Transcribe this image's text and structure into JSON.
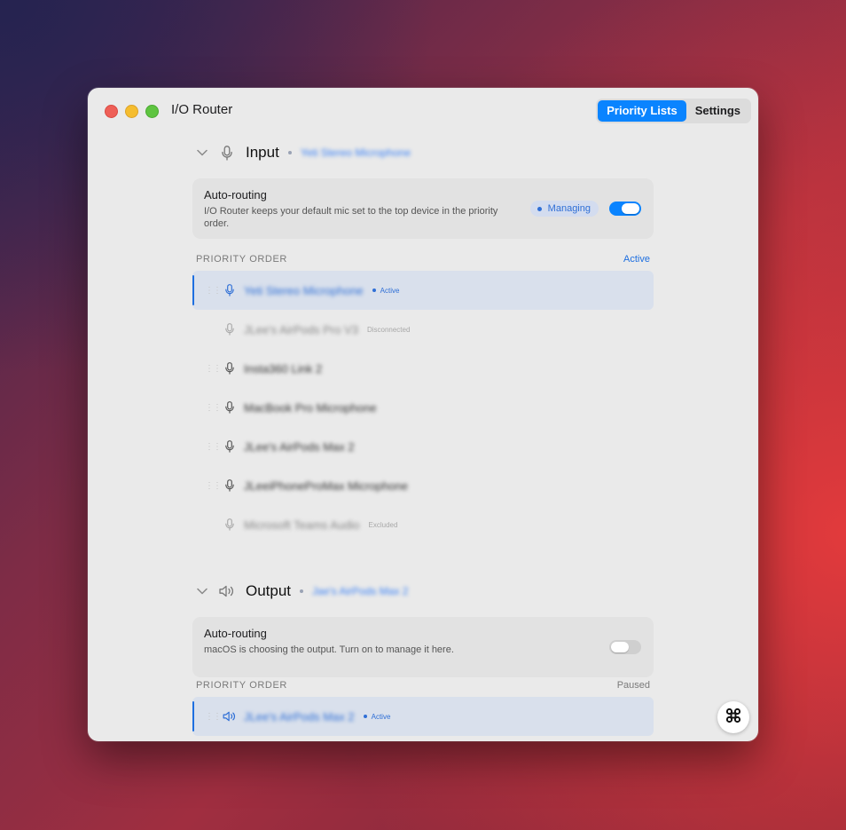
{
  "window": {
    "title": "I/O Router"
  },
  "tabs": [
    {
      "label": "Priority Lists",
      "active": true
    },
    {
      "label": "Settings",
      "active": false
    }
  ],
  "input": {
    "title": "Input",
    "current_device": "Yeti Stereo Microphone",
    "auto_routing": {
      "title": "Auto-routing",
      "description": "I/O Router keeps your default mic set to the top device in the priority order.",
      "status_pill": "Managing",
      "enabled": true
    },
    "priority_order_label": "PRIORITY ORDER",
    "priority_state": "Active",
    "devices": [
      {
        "name": "Yeti Stereo Microphone",
        "status": "Active"
      },
      {
        "name": "JLee's AirPods Pro V3",
        "status": "Disconnected"
      },
      {
        "name": "Insta360 Link 2",
        "status": ""
      },
      {
        "name": "MacBook Pro Microphone",
        "status": ""
      },
      {
        "name": "JLee's AirPods Max 2",
        "status": ""
      },
      {
        "name": "JLeeiPhoneProMax Microphone",
        "status": ""
      },
      {
        "name": "Microsoft Teams Audio",
        "status": "Excluded"
      }
    ]
  },
  "output": {
    "title": "Output",
    "current_device": "Jae's AirPods Max 2",
    "auto_routing": {
      "title": "Auto-routing",
      "description": "macOS is choosing the output. Turn on to manage it here.",
      "enabled": false
    },
    "priority_order_label": "PRIORITY ORDER",
    "priority_state": "Paused",
    "devices": [
      {
        "name": "JLee's AirPods Max 2",
        "status": "Active"
      }
    ]
  },
  "icons": {
    "input": "microphone-icon",
    "output": "speaker-icon",
    "collapse": "chevron-down-icon",
    "fab": "command-icon"
  },
  "colors": {
    "accent": "#0a84ff",
    "active_text": "#2f6fd6",
    "active_row_bg": "#d9e0ec",
    "window_bg": "#eaeaea"
  }
}
